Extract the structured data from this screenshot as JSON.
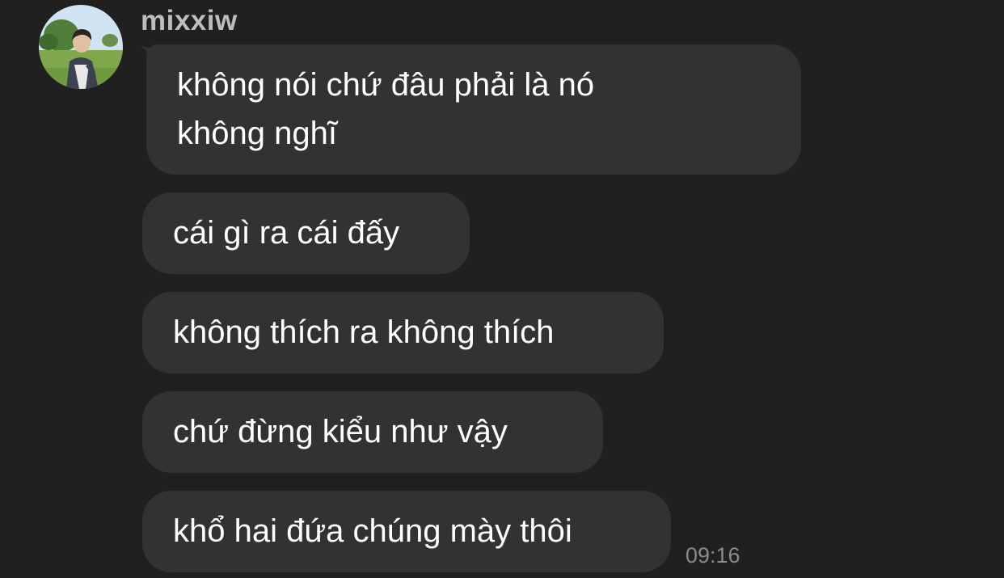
{
  "sender": {
    "name": "mixxiw"
  },
  "messages": [
    {
      "lines": [
        [
          "không",
          "nói",
          "chứ",
          "đâu",
          "phải",
          "là",
          "nó"
        ],
        "không nghĩ"
      ]
    },
    {
      "text": "cái gì ra cái đấy"
    },
    {
      "text": "không thích ra không thích"
    },
    {
      "text": "chứ đừng kiểu như vậy"
    },
    {
      "text": "khổ hai đứa chúng mày thôi"
    }
  ],
  "timestamp": "09:16",
  "colors": {
    "background": "#202020",
    "bubble": "#323232",
    "text": "#ffffff",
    "sender": "#bdbdbd",
    "timestamp": "#8a8a8a"
  },
  "icons": {
    "avatar": "profile-photo"
  }
}
